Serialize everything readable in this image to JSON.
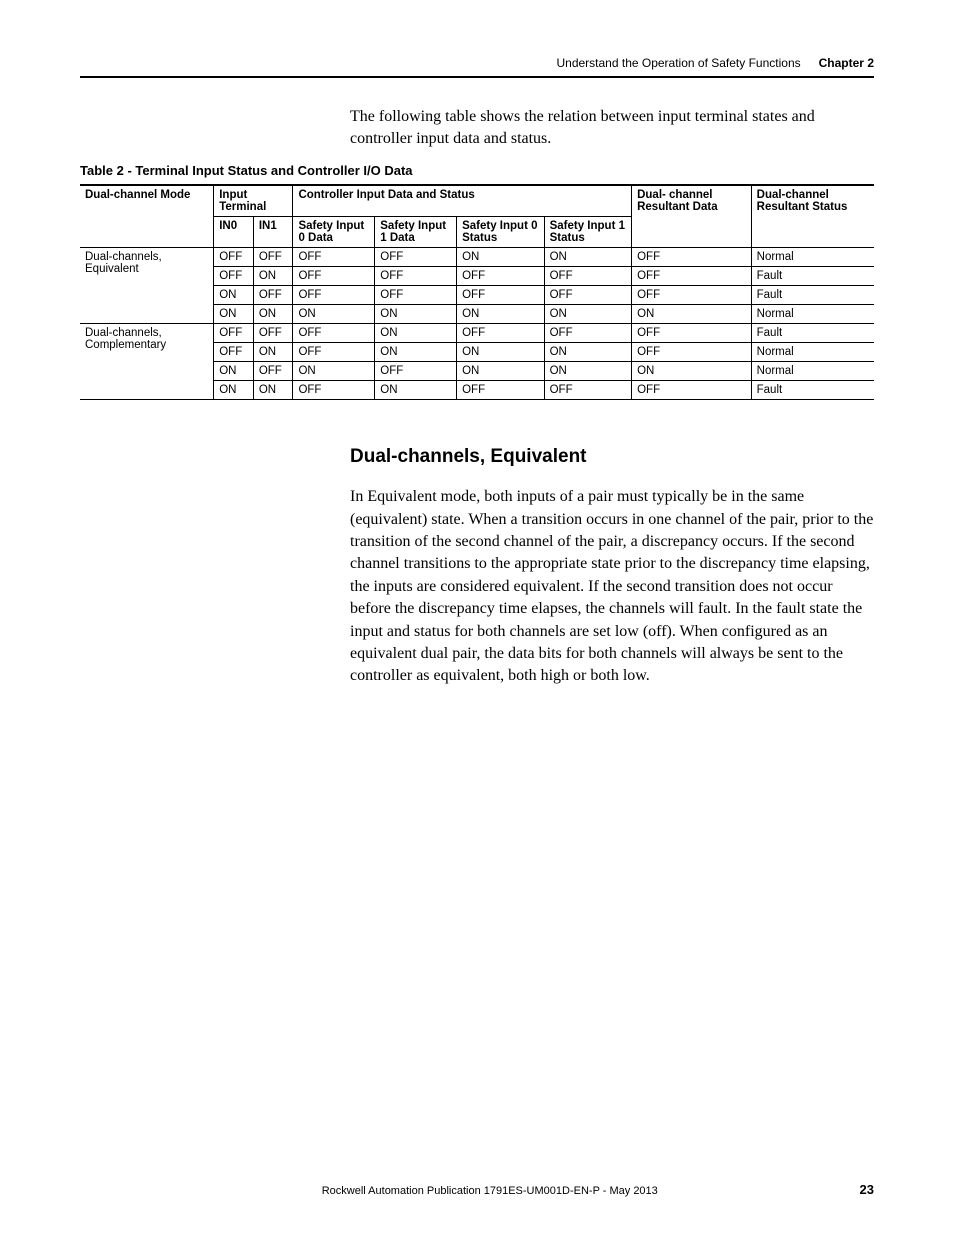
{
  "header": {
    "title": "Understand the Operation of Safety Functions",
    "chapter": "Chapter 2"
  },
  "intro": "The following table shows the relation between input terminal states and controller input data and status.",
  "table": {
    "caption": "Table 2 - Terminal Input Status and Controller I/O Data",
    "head": {
      "mode": "Dual-channel Mode",
      "input_terminal": "Input Terminal",
      "controller": "Controller Input Data and Status",
      "dc_result_data": "Dual- channel Resultant Data",
      "dc_result_status": "Dual-channel Resultant Status",
      "in0": "IN0",
      "in1": "IN1",
      "s0d": "Safety Input 0 Data",
      "s1d": "Safety Input 1 Data",
      "s0s": "Safety Input 0 Status",
      "s1s": "Safety Input 1 Status"
    },
    "groups": [
      {
        "mode": "Dual-channels, Equivalent",
        "rows": [
          {
            "in0": "OFF",
            "in1": "OFF",
            "s0d": "OFF",
            "s1d": "OFF",
            "s0s": "ON",
            "s1s": "ON",
            "rd": "OFF",
            "rs": "Normal"
          },
          {
            "in0": "OFF",
            "in1": "ON",
            "s0d": "OFF",
            "s1d": "OFF",
            "s0s": "OFF",
            "s1s": "OFF",
            "rd": "OFF",
            "rs": "Fault"
          },
          {
            "in0": "ON",
            "in1": "OFF",
            "s0d": "OFF",
            "s1d": "OFF",
            "s0s": "OFF",
            "s1s": "OFF",
            "rd": "OFF",
            "rs": "Fault"
          },
          {
            "in0": "ON",
            "in1": "ON",
            "s0d": "ON",
            "s1d": "ON",
            "s0s": "ON",
            "s1s": "ON",
            "rd": "ON",
            "rs": "Normal"
          }
        ]
      },
      {
        "mode": "Dual-channels, Complementary",
        "rows": [
          {
            "in0": "OFF",
            "in1": "OFF",
            "s0d": "OFF",
            "s1d": "ON",
            "s0s": "OFF",
            "s1s": "OFF",
            "rd": "OFF",
            "rs": "Fault"
          },
          {
            "in0": "OFF",
            "in1": "ON",
            "s0d": "OFF",
            "s1d": "ON",
            "s0s": "ON",
            "s1s": "ON",
            "rd": "OFF",
            "rs": "Normal"
          },
          {
            "in0": "ON",
            "in1": "OFF",
            "s0d": "ON",
            "s1d": "OFF",
            "s0s": "ON",
            "s1s": "ON",
            "rd": "ON",
            "rs": "Normal"
          },
          {
            "in0": "ON",
            "in1": "ON",
            "s0d": "OFF",
            "s1d": "ON",
            "s0s": "OFF",
            "s1s": "OFF",
            "rd": "OFF",
            "rs": "Fault"
          }
        ]
      }
    ]
  },
  "section": {
    "heading": "Dual-channels, Equivalent",
    "body": "In Equivalent mode, both inputs of a pair must typically be in the same (equivalent) state. When a transition occurs in one channel of the pair, prior to the transition of the second channel of the pair, a discrepancy occurs. If the second channel transitions to the appropriate state prior to the discrepancy time elapsing, the inputs are considered equivalent. If the second transition does not occur before the discrepancy time elapses, the channels will fault. In the fault state the input and status for both channels are set low (off). When configured as an equivalent dual pair, the data bits for both channels will always be sent to the controller as equivalent, both high or both low."
  },
  "footer": {
    "publication": "Rockwell Automation Publication 1791ES-UM001D-EN-P - May 2013",
    "page": "23"
  }
}
